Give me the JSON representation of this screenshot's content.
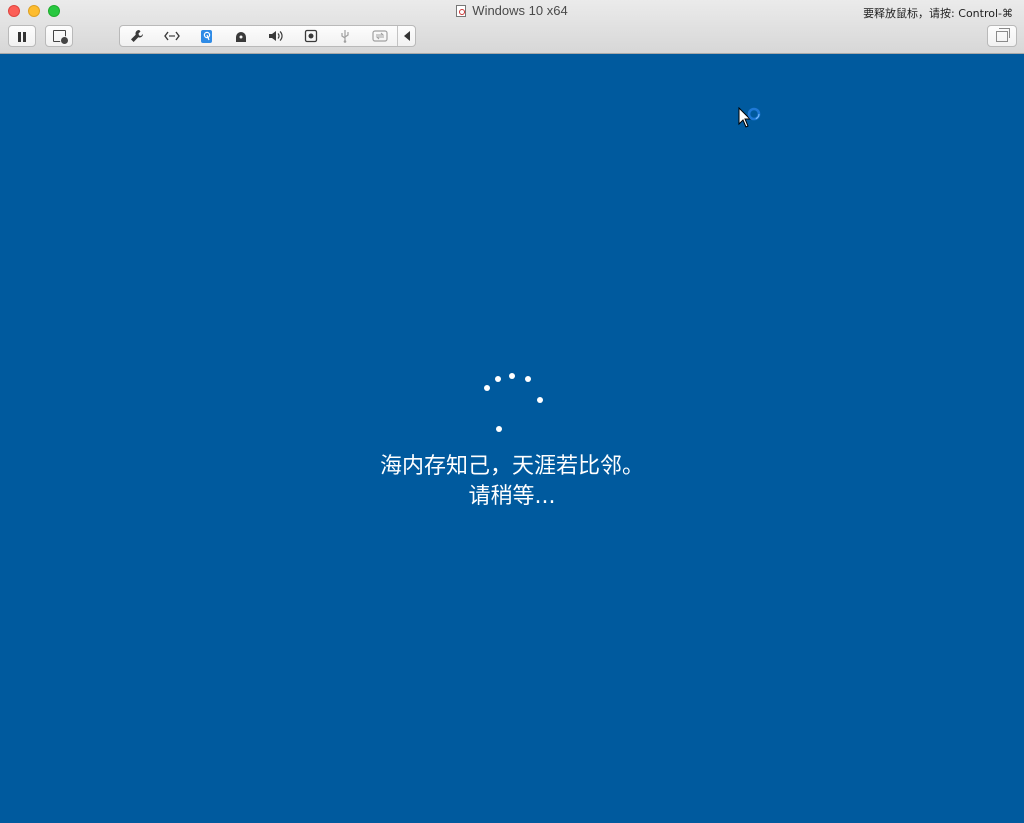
{
  "window": {
    "title": "Windows 10 x64",
    "release_hint": "要释放鼠标，请按: Control-⌘"
  },
  "toolbar": {
    "pause_icon": "pause-icon",
    "snapshot_icon": "snapshot-icon",
    "restore_icon": "restore-window-icon",
    "devices": [
      {
        "name": "settings-wrench-icon",
        "glyph": "🔧",
        "dim": false
      },
      {
        "name": "network-icon",
        "glyph": "‹·›",
        "dim": false
      },
      {
        "name": "harddisk-icon",
        "glyph": "⛁",
        "dim": false
      },
      {
        "name": "cd-dvd-icon",
        "glyph": "◓",
        "dim": false
      },
      {
        "name": "sound-icon",
        "glyph": "🔊",
        "dim": false
      },
      {
        "name": "camera-icon",
        "glyph": "◙",
        "dim": false
      },
      {
        "name": "usb-icon",
        "glyph": "Ψ",
        "dim": true
      },
      {
        "name": "sharing-icon",
        "glyph": "⇄",
        "dim": true
      }
    ],
    "collapse_icon": "collapse-arrow-icon"
  },
  "guest": {
    "background": "#005a9e",
    "message_line1": "海内存知己，天涯若比邻。",
    "message_line2": "请稍等..."
  },
  "colors": {
    "accent": "#2f8be6",
    "close": "#fc5f57",
    "minimize": "#fdbc2e",
    "maximize": "#28c840"
  }
}
